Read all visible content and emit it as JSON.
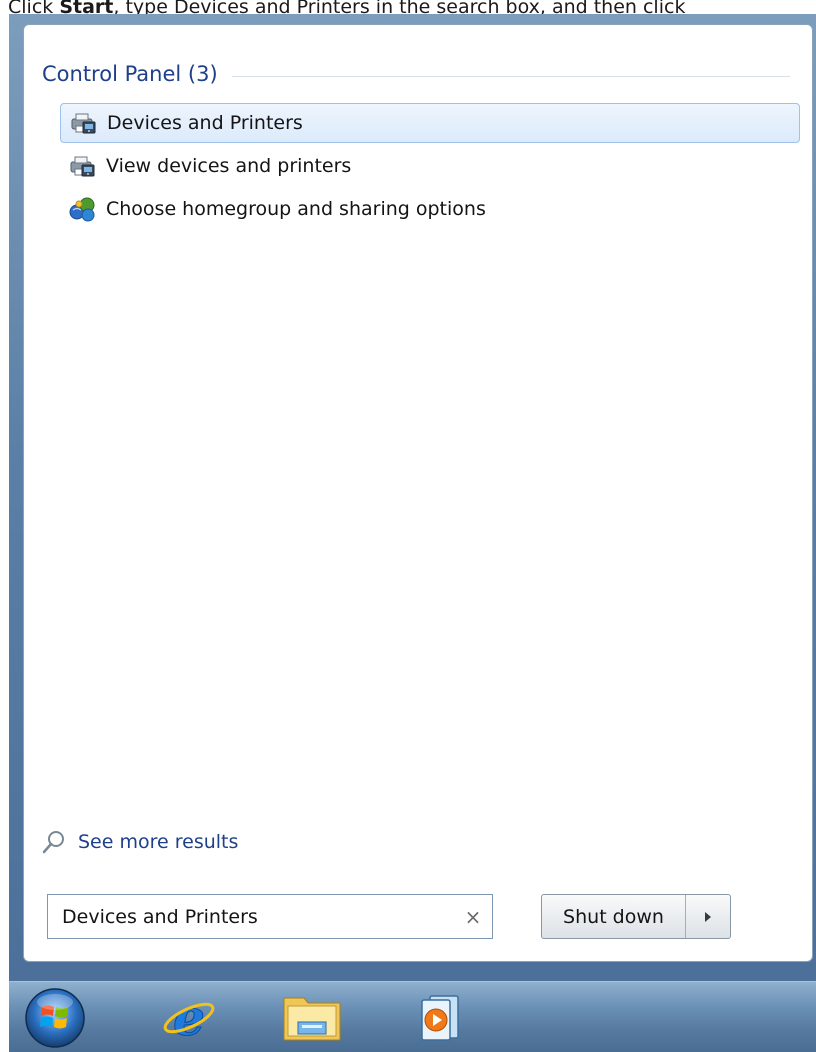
{
  "instruction": {
    "prefix": "Click ",
    "bold": "Start",
    "suffix": ", type Devices and Printers in the search box, and then click"
  },
  "start_menu": {
    "group": {
      "title": "Control Panel (3)"
    },
    "results": [
      {
        "label": "Devices and Printers",
        "icon": "devices-printers-icon",
        "selected": true
      },
      {
        "label": "View devices and printers",
        "icon": "devices-printers-icon",
        "selected": false
      },
      {
        "label": "Choose homegroup and sharing options",
        "icon": "homegroup-icon",
        "selected": false
      }
    ],
    "see_more": {
      "label": "See more results",
      "icon": "search-icon"
    },
    "search": {
      "value": "Devices and Printers",
      "clear_glyph": "×"
    },
    "shutdown": {
      "label": "Shut down"
    }
  },
  "taskbar": {
    "items": [
      {
        "icon": "windows-start-orb-icon"
      },
      {
        "icon": "internet-explorer-icon"
      },
      {
        "icon": "file-explorer-icon"
      },
      {
        "icon": "media-player-icon"
      }
    ]
  },
  "colors": {
    "link_blue": "#1e3f8a",
    "selection_border": "#9ec2ea",
    "taskbar_blue": "#5b7fa6"
  }
}
